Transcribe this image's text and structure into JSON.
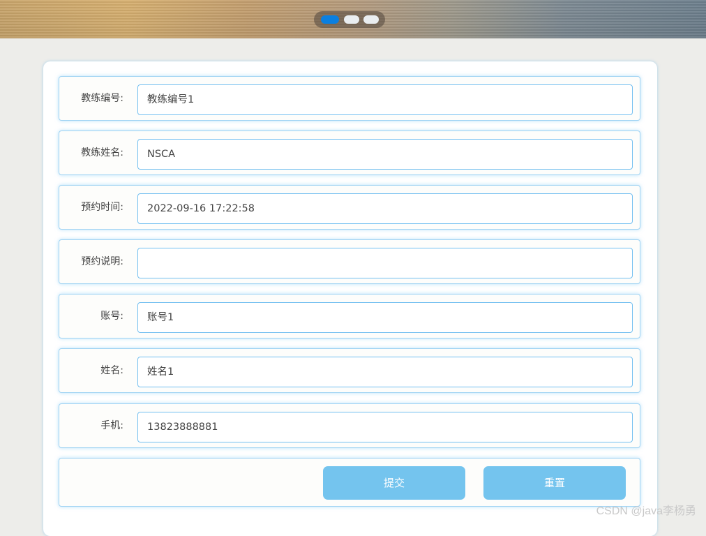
{
  "carousel": {
    "dots": [
      {
        "active": true
      },
      {
        "active": false
      },
      {
        "active": false
      }
    ]
  },
  "form": {
    "fields": [
      {
        "label": "教练编号:",
        "value": "教练编号1"
      },
      {
        "label": "教练姓名:",
        "value": "NSCA"
      },
      {
        "label": "预约时间:",
        "value": "2022-09-16 17:22:58"
      },
      {
        "label": "预约说明:",
        "value": ""
      },
      {
        "label": "账号:",
        "value": "账号1"
      },
      {
        "label": "姓名:",
        "value": "姓名1"
      },
      {
        "label": "手机:",
        "value": "13823888881"
      }
    ],
    "submit_label": "提交",
    "reset_label": "重置"
  },
  "watermark": "CSDN @java李杨勇",
  "colors": {
    "accent": "#0a7fe0",
    "button": "#74c4ee",
    "input_border": "#72bff0"
  }
}
